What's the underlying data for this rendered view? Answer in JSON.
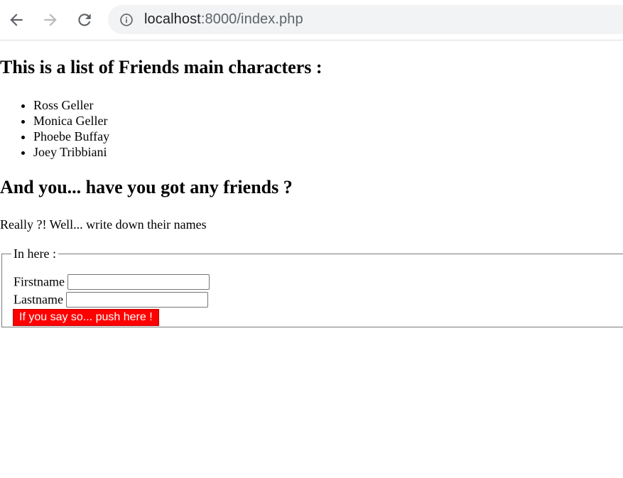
{
  "browser": {
    "url_host": "localhost",
    "url_rest": ":8000/index.php",
    "icons": {
      "back": "arrow-left-icon",
      "forward": "arrow-right-icon",
      "reload": "reload-icon",
      "info": "info-icon"
    }
  },
  "page": {
    "heading_list": "This is a list of Friends main characters :",
    "friends": [
      "Ross Geller",
      "Monica Geller",
      "Phoebe Buffay",
      "Joey Tribbiani"
    ],
    "heading_ask": "And you... have you got any friends ?",
    "paragraph": "Really ?! Well... write down their names",
    "form": {
      "legend": "In here :",
      "firstname_label": "Firstname",
      "firstname_value": "",
      "lastname_label": "Lastname",
      "lastname_value": "",
      "submit_label": "If you say so... push here !",
      "submit_color": "#ff0000"
    }
  }
}
